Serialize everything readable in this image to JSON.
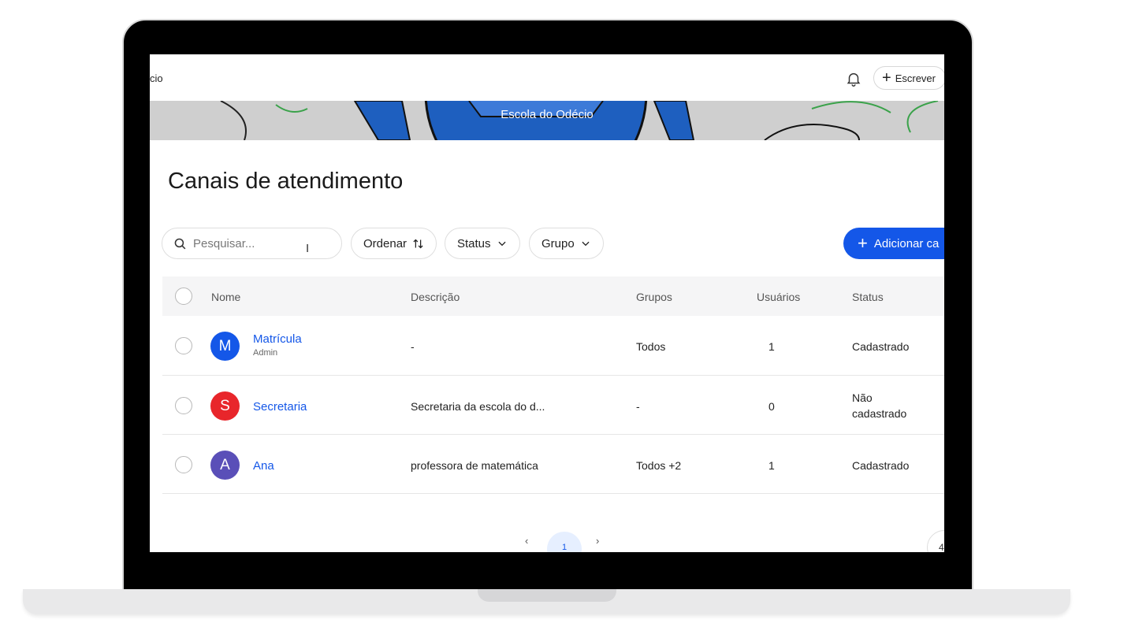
{
  "topbar": {
    "breadcrumb": "cio",
    "write_label": "Escrever"
  },
  "banner": {
    "school_name": "Escola do Odécio"
  },
  "page": {
    "title": "Canais de atendimento"
  },
  "toolbar": {
    "search_placeholder": "Pesquisar...",
    "sort_label": "Ordenar",
    "status_label": "Status",
    "group_label": "Grupo",
    "add_label": "Adicionar ca"
  },
  "table": {
    "columns": {
      "name": "Nome",
      "description": "Descrição",
      "groups": "Grupos",
      "users": "Usuários",
      "status": "Status"
    },
    "rows": [
      {
        "initial": "M",
        "name": "Matrícula",
        "sub": "Admin",
        "description": "-",
        "groups": "Todos",
        "users": "1",
        "status": "Cadastrado",
        "avatar_color": "#1457e8"
      },
      {
        "initial": "S",
        "name": "Secretaria",
        "sub": "",
        "description": "Secretaria da escola do d...",
        "groups": "-",
        "users": "0",
        "status_line1": "Não",
        "status_line2": "cadastrado",
        "avatar_color": "#e8262b"
      },
      {
        "initial": "A",
        "name": "Ana",
        "sub": "",
        "description": "professora de matemática",
        "groups": "Todos +2",
        "users": "1",
        "status": "Cadastrado",
        "avatar_color": "#5a4fb8"
      }
    ]
  },
  "pagination": {
    "current": "1",
    "page_size": "4",
    "prev_icon": "chevron-left-icon",
    "next_icon": "chevron-right-icon"
  },
  "colors": {
    "accent": "#1457e8"
  }
}
